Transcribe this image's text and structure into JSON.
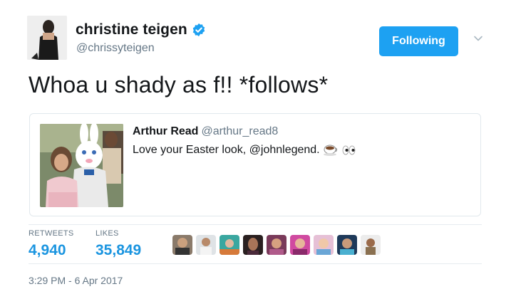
{
  "author": {
    "display_name": "christine teigen",
    "handle": "@chrissyteigen",
    "verified": true
  },
  "follow_button": {
    "label": "Following"
  },
  "tweet": {
    "text": "Whoa u shady as f!! *follows*",
    "timestamp": "3:29 PM - 6 Apr 2017"
  },
  "quoted_tweet": {
    "display_name": "Arthur Read",
    "handle": "@arthur_read8",
    "text": "Love your Easter look, @johnlegend.",
    "emoji": [
      "coffee-icon",
      "eyes-icon"
    ]
  },
  "stats": {
    "retweets_label": "RETWEETS",
    "retweets_value": "4,940",
    "likes_label": "LIKES",
    "likes_value": "35,849"
  },
  "likers_count_shown": 9,
  "colors": {
    "accent": "#1da1f2",
    "stat_value": "#1b95e0",
    "secondary_text": "#657786",
    "border": "#e1e8ed"
  }
}
